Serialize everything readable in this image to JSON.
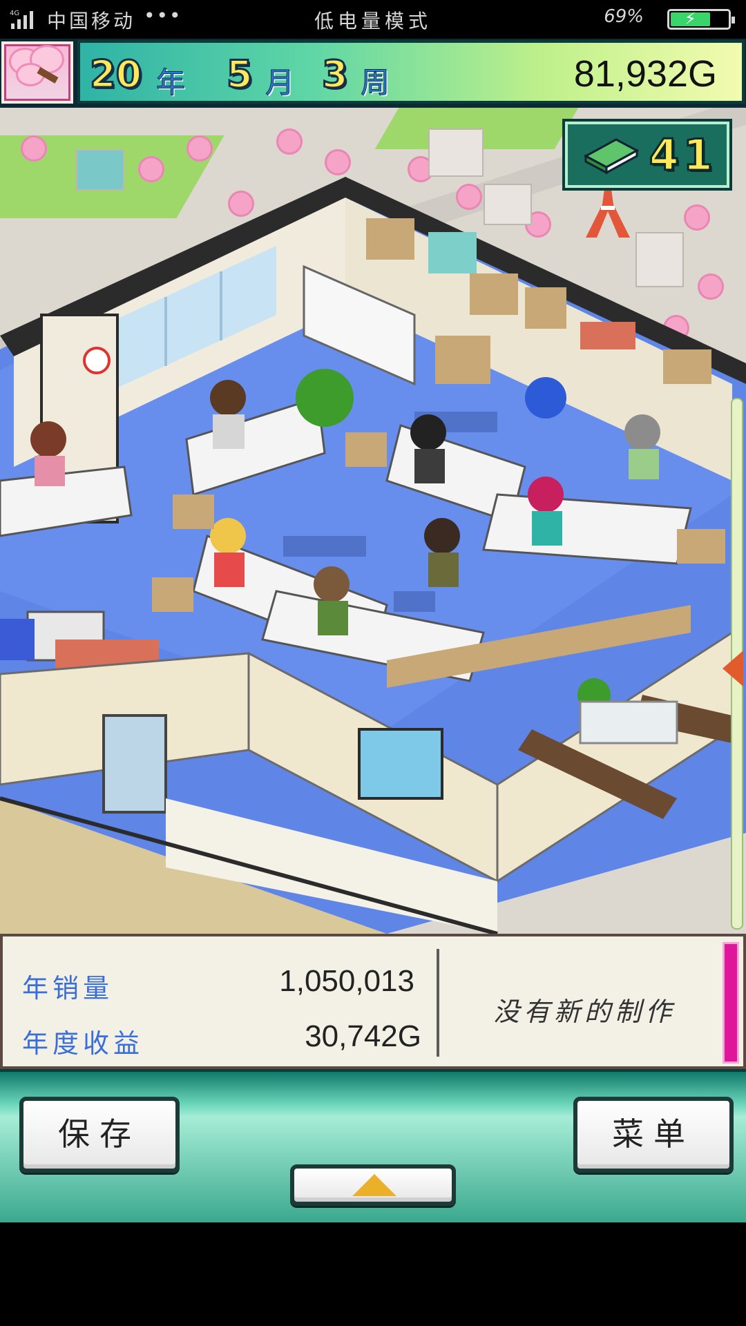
{
  "status_bar": {
    "network": "4G",
    "carrier": "中国移动",
    "dots": "•••",
    "mode": "低电量模式",
    "battery_percent": "69%",
    "battery_level": 0.69,
    "battery_color": "#39d56a"
  },
  "top_bar": {
    "year_num": "20",
    "year_unit": "年",
    "month_num": "5",
    "month_unit": "月",
    "week_num": "3",
    "week_unit": "周",
    "money": "81,932G",
    "season_icon": "cherry-blossom-icon"
  },
  "books_badge": {
    "icon": "book-icon",
    "count": "41"
  },
  "info_panel": {
    "annual_sales_label": "年销量",
    "annual_sales_value": "1,050,013",
    "annual_revenue_label": "年度收益",
    "annual_revenue_value": "30,742G",
    "production_status": "没有新的制作"
  },
  "bottom_bar": {
    "save_label": "保存",
    "menu_label": "菜单",
    "expand_icon": "chevron-up-icon"
  },
  "colors": {
    "accent_teal": "#2fb3a6",
    "label_blue": "#3a6fd6",
    "pink_bar": "#e0169a",
    "up_arrow": "#eab02a"
  }
}
